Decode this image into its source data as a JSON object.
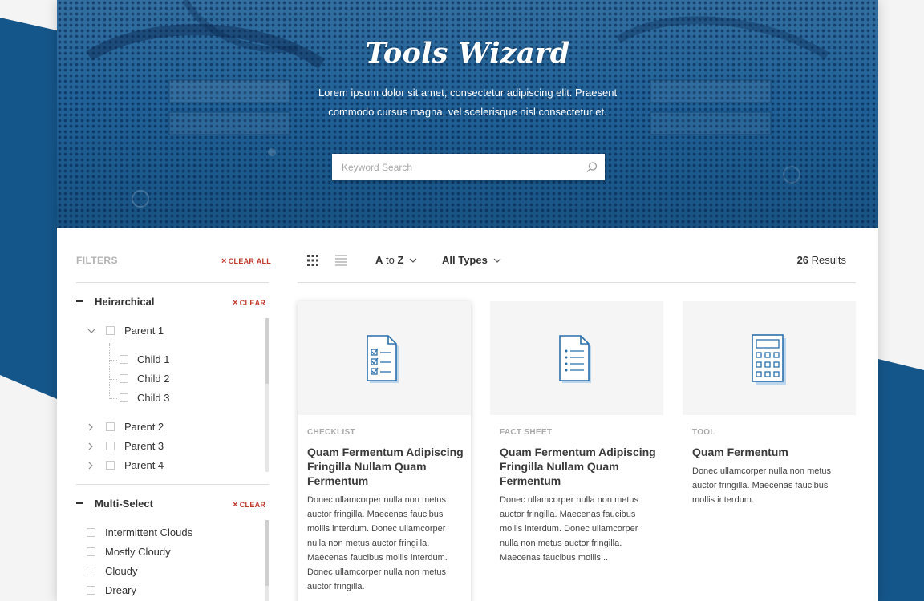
{
  "hero": {
    "title": "Tools Wizard",
    "subtitle": "Lorem ipsum dolor sit amet, consectetur adipiscing elit. Praesent commodo cursus magna, vel scelerisque nisl consectetur et.",
    "search_placeholder": "Keyword Search",
    "search_icon": "search-icon"
  },
  "filters": {
    "title": "FILTERS",
    "clear_all": "CLEAR ALL",
    "clear": "CLEAR",
    "hierarchical": {
      "title": "Heirarchical",
      "parents": [
        {
          "label": "Parent 1",
          "expanded": true,
          "children": [
            "Child 1",
            "Child 2",
            "Child 3"
          ]
        },
        {
          "label": "Parent 2",
          "expanded": false
        },
        {
          "label": "Parent 3",
          "expanded": false
        },
        {
          "label": "Parent 4",
          "expanded": false
        }
      ]
    },
    "multi_select": {
      "title": "Multi-Select",
      "options": [
        "Intermittent Clouds",
        "Mostly Cloudy",
        "Cloudy",
        "Dreary"
      ]
    }
  },
  "toolbar": {
    "sort_a": "A",
    "sort_to": " to ",
    "sort_z": "Z",
    "type_filter": "All Types",
    "results_count": "26",
    "results_label": " Results"
  },
  "cards": [
    {
      "type": "CHECKLIST",
      "icon": "checklist-icon",
      "title": "Quam Fermentum Adipiscing Fringilla Nullam Quam Fermentum",
      "description": "Donec ullamcorper nulla non metus auctor fringilla. Maecenas faucibus mollis interdum. Donec ullamcorper nulla non metus auctor fringilla. Maecenas faucibus mollis interdum. Donec ullamcorper nulla non metus auctor fringilla."
    },
    {
      "type": "FACT SHEET",
      "icon": "fact-sheet-icon",
      "title": "Quam Fermentum Adipiscing Fringilla Nullam Quam Fermentum",
      "description": "Donec ullamcorper nulla non metus auctor fringilla. Maecenas faucibus mollis interdum. Donec ullamcorper nulla non metus auctor fringilla. Maecenas faucibus mollis..."
    },
    {
      "type": "TOOL",
      "icon": "calculator-icon",
      "title": "Quam Fermentum",
      "description": "Donec ullamcorper nulla non metus auctor fringilla. Maecenas faucibus mollis interdum."
    }
  ],
  "colors": {
    "brand_blue": "#1c5e95",
    "background_blue": "#15568a",
    "clear_red": "#c0392b",
    "icon_blue": "#2b6fab",
    "icon_light": "#bcd6ee"
  }
}
